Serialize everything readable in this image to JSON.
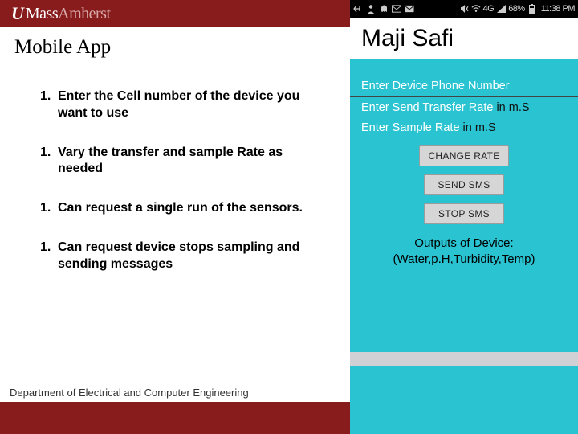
{
  "header": {
    "logo_u": "U",
    "logo_mass": "Mass",
    "logo_amherst": "Amherst"
  },
  "slide": {
    "title": "Mobile App",
    "bullets": [
      {
        "num": "1.",
        "text": "Enter the Cell number of the device you want to use"
      },
      {
        "num": "1.",
        "text": "Vary the transfer and sample Rate as needed"
      },
      {
        "num": "1.",
        "text": "Can request a single run of the sensors."
      },
      {
        "num": "1.",
        "text": "Can request device stops sampling and sending messages"
      }
    ],
    "department": "Department of Electrical and Computer Engineering"
  },
  "phone": {
    "status": {
      "battery_pct": "68%",
      "time": "11:38 PM",
      "network_label": "4G"
    },
    "app_title": "Maji Safi",
    "fields": [
      {
        "placeholder": "Enter Device Phone Number",
        "suffix": ""
      },
      {
        "placeholder": "Enter Send Transfer Rate",
        "suffix": " in m.S"
      },
      {
        "placeholder": "Enter Sample Rate",
        "suffix": " in m.S"
      }
    ],
    "buttons": {
      "change_rate": "CHANGE RATE",
      "send_sms": "SEND SMS",
      "stop_sms": "STOP SMS"
    },
    "outputs_label": "Outputs of Device:",
    "outputs_values": "(Water,p.H,Turbidity,Temp)"
  },
  "colors": {
    "brand_red": "#881c1c",
    "app_bg": "#29c3d1"
  }
}
